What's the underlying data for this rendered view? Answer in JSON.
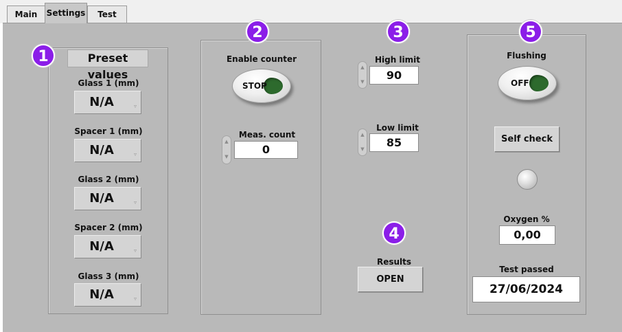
{
  "tabs": [
    {
      "label": "Main"
    },
    {
      "label": "Settings"
    },
    {
      "label": "Test"
    }
  ],
  "active_tab": "Settings",
  "badges": [
    "1",
    "2",
    "3",
    "4",
    "5"
  ],
  "preset": {
    "title": "Preset values",
    "fields": [
      {
        "label": "Glass 1 (mm)",
        "value": "N/A"
      },
      {
        "label": "Spacer 1 (mm)",
        "value": "N/A"
      },
      {
        "label": "Glass 2 (mm)",
        "value": "N/A"
      },
      {
        "label": "Spacer 2 (mm)",
        "value": "N/A"
      },
      {
        "label": "Glass 3 (mm)",
        "value": "N/A"
      }
    ]
  },
  "counter": {
    "enable_label": "Enable counter",
    "toggle_text": "STOP",
    "meas_label": "Meas. count",
    "meas_value": "0"
  },
  "limits": {
    "high_label": "High limit",
    "high_value": "90",
    "low_label": "Low limit",
    "low_value": "85"
  },
  "results": {
    "label": "Results",
    "button": "OPEN"
  },
  "flushing": {
    "label": "Flushing",
    "toggle_text": "OFF",
    "self_check": "Self check",
    "oxygen_label": "Oxygen %",
    "oxygen_value": "0,00",
    "test_passed_label": "Test passed",
    "test_passed_value": "27/06/2024"
  },
  "colors": {
    "badge": "#8b1ee8",
    "panel_bg": "#b9b9b9",
    "led_green": "#2d6a2d"
  }
}
